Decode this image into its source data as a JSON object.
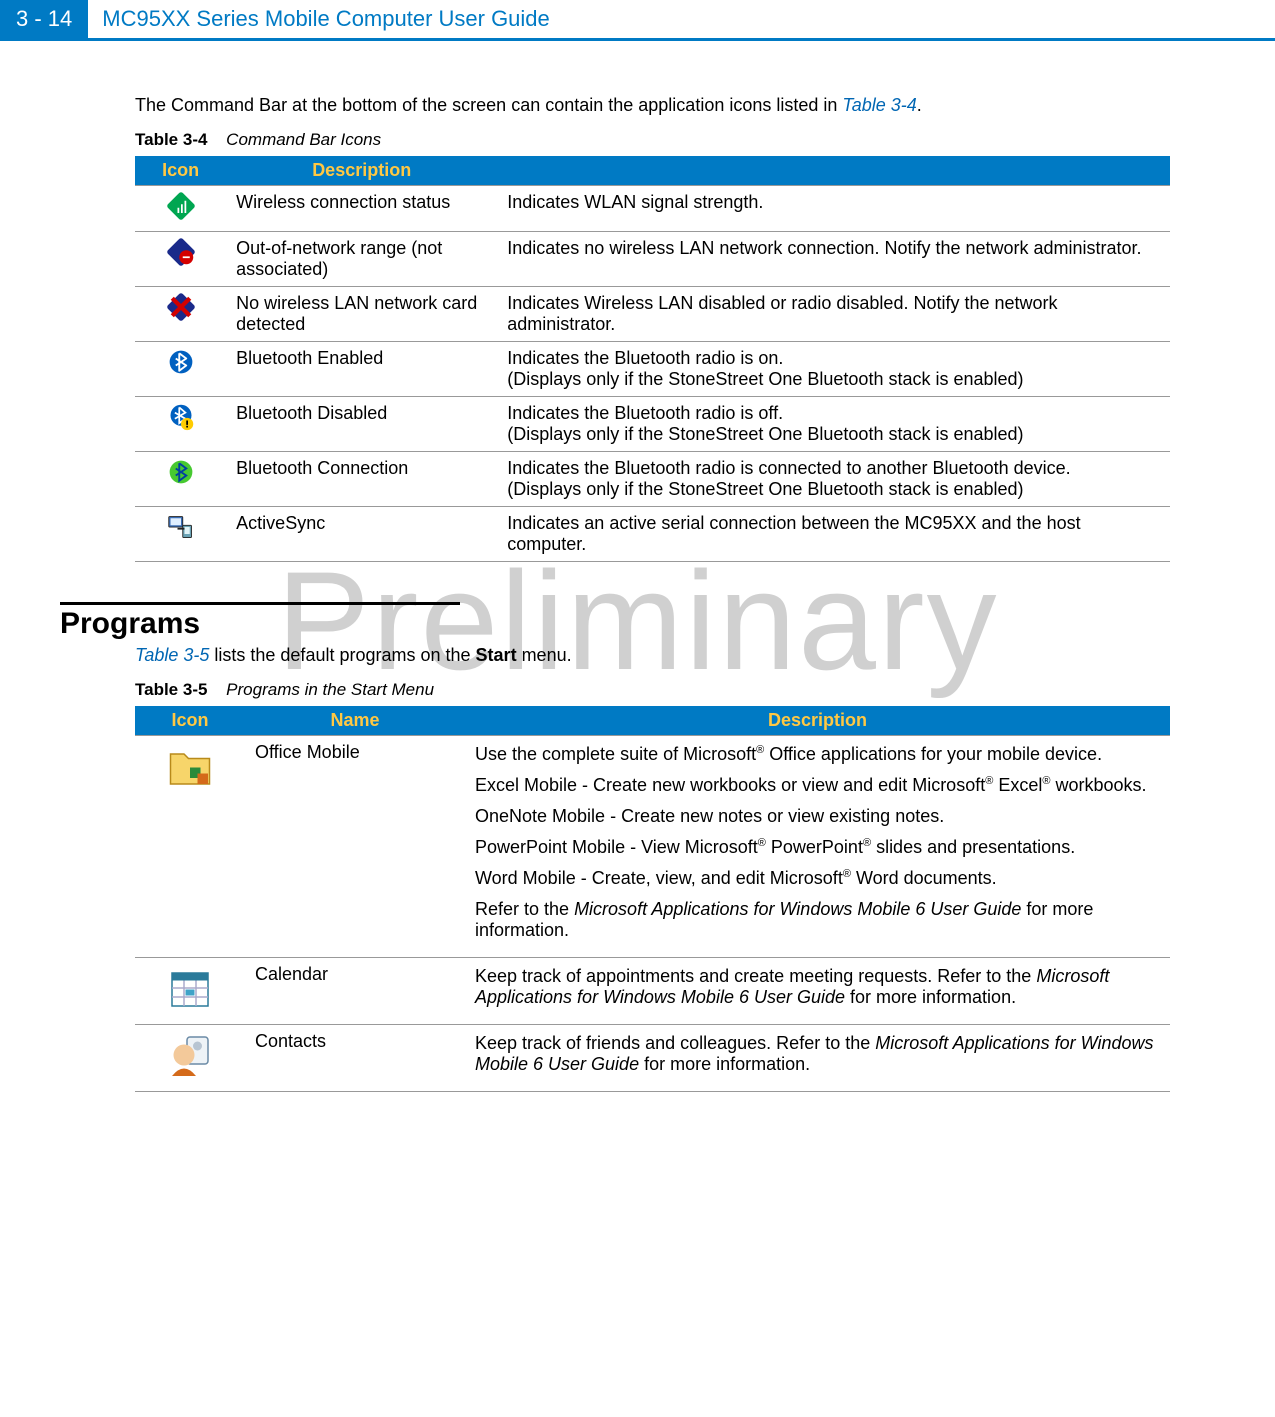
{
  "header": {
    "page_num": "3 - 14",
    "doc_title": "MC95XX Series Mobile Computer User Guide"
  },
  "watermark": "Preliminary",
  "intro": {
    "text_a": "The Command Bar at the bottom of the screen can contain the application icons listed in ",
    "xref": "Table 3-4",
    "text_b": "."
  },
  "table34": {
    "caption_label": "Table 3-4",
    "caption_title": "Command Bar Icons",
    "headers": {
      "icon": "Icon",
      "desc": "Description"
    },
    "rows": [
      {
        "icon_name": "wlan-signal-icon",
        "name": "Wireless connection status",
        "desc": "Indicates WLAN signal strength."
      },
      {
        "icon_name": "wlan-out-of-range-icon",
        "name": "Out-of-network range (not associated)",
        "desc": "Indicates no wireless LAN network connection. Notify the network administrator."
      },
      {
        "icon_name": "wlan-no-card-icon",
        "name": "No wireless LAN network card detected",
        "desc": "Indicates Wireless LAN disabled or radio disabled. Notify the network administrator."
      },
      {
        "icon_name": "bluetooth-enabled-icon",
        "name": "Bluetooth Enabled",
        "desc": "Indicates the Bluetooth radio is on.\n(Displays only if the StoneStreet One Bluetooth stack is enabled)"
      },
      {
        "icon_name": "bluetooth-disabled-icon",
        "name": "Bluetooth Disabled",
        "desc": "Indicates the Bluetooth radio is off.\n(Displays only if the StoneStreet One Bluetooth stack is enabled)"
      },
      {
        "icon_name": "bluetooth-connection-icon",
        "name": "Bluetooth Connection",
        "desc": "Indicates the Bluetooth radio is connected to another Bluetooth device.\n(Displays only if the StoneStreet One Bluetooth stack is enabled)"
      },
      {
        "icon_name": "activesync-icon",
        "name": "ActiveSync",
        "desc": "Indicates an active serial connection between the MC95XX and the host computer."
      }
    ]
  },
  "section_programs": {
    "heading": "Programs",
    "intro_a": "",
    "xref": "Table 3-5",
    "intro_b": " lists the default programs on the ",
    "bold": "Start",
    "intro_c": " menu."
  },
  "table35": {
    "caption_label": "Table 3-5",
    "caption_title": "Programs in the Start Menu",
    "headers": {
      "icon": "Icon",
      "name": "Name",
      "desc": "Description"
    },
    "rows": [
      {
        "icon_name": "office-mobile-folder-icon",
        "name": "Office Mobile",
        "paras": [
          {
            "type": "plain",
            "pre": "Use the complete suite of Microsoft",
            "sup1": "®",
            "post": " Office applications for your mobile device."
          },
          {
            "type": "plain",
            "pre": "Excel Mobile - Create new workbooks or view and edit Microsoft",
            "sup1": "®",
            "mid": " Excel",
            "sup2": "®",
            "post": " workbooks."
          },
          {
            "type": "simple",
            "text": "OneNote Mobile - Create new notes or view existing notes."
          },
          {
            "type": "plain",
            "pre": "PowerPoint Mobile - View Microsoft",
            "sup1": "®",
            "mid": " PowerPoint",
            "sup2": "®",
            "post": " slides and presentations."
          },
          {
            "type": "plain",
            "pre": "Word Mobile - Create, view, and edit Microsoft",
            "sup1": "®",
            "post": " Word documents."
          },
          {
            "type": "ref",
            "pre": "Refer to the ",
            "ital": "Microsoft Applications for Windows Mobile 6 User Guide",
            "post": " for more information."
          }
        ]
      },
      {
        "icon_name": "calendar-icon",
        "name": "Calendar",
        "paras": [
          {
            "type": "ref",
            "pre": "Keep track of appointments and create meeting requests. Refer to the ",
            "ital": "Microsoft Applications for Windows Mobile 6 User Guide",
            "post": " for more information."
          }
        ]
      },
      {
        "icon_name": "contacts-icon",
        "name": "Contacts",
        "paras": [
          {
            "type": "ref",
            "pre": "Keep track of friends and colleagues. Refer to the ",
            "ital": "Microsoft Applications for Windows Mobile 6 User Guide",
            "post": " for more information."
          }
        ]
      }
    ]
  }
}
